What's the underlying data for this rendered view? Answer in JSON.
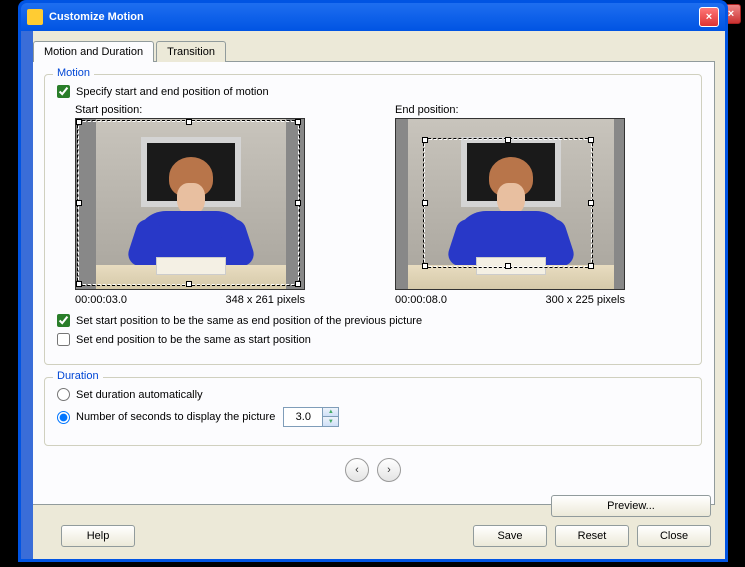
{
  "window": {
    "title": "Customize Motion"
  },
  "tabs": {
    "active": "Motion and Duration",
    "other": "Transition"
  },
  "motion": {
    "group_title": "Motion",
    "specify_label": "Specify start and end position of motion",
    "specify_checked": true,
    "start_label": "Start position:",
    "end_label": "End position:",
    "start_time": "00:00:03.0",
    "start_dims": "348 x 261 pixels",
    "end_time": "00:00:08.0",
    "end_dims": "300 x 225 pixels",
    "same_as_prev_label": "Set start position to be the same as end position of the previous picture",
    "same_as_prev_checked": true,
    "same_as_start_label": "Set end position to be the same as start position",
    "same_as_start_checked": false
  },
  "duration": {
    "group_title": "Duration",
    "auto_label": "Set duration automatically",
    "seconds_label": "Number of seconds to display the picture",
    "selected": "seconds",
    "value": "3.0"
  },
  "buttons": {
    "preview": "Preview...",
    "help": "Help",
    "save": "Save",
    "reset": "Reset",
    "close": "Close"
  }
}
